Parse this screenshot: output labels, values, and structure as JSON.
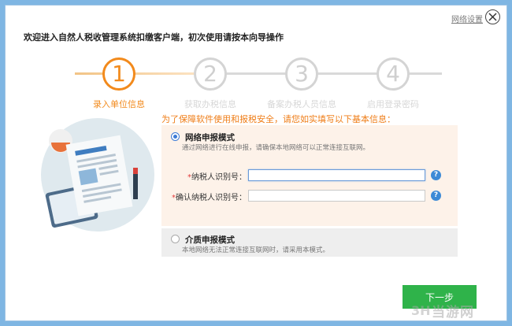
{
  "header": {
    "net_settings": "网络设置",
    "welcome": "欢迎进入自然人税收管理系统扣缴客户端，初次使用请按本向导操作"
  },
  "steps": [
    {
      "num": "1",
      "label": "录入单位信息"
    },
    {
      "num": "2",
      "label": "获取办税信息"
    },
    {
      "num": "3",
      "label": "备案办税人员信息"
    },
    {
      "num": "4",
      "label": "启用登录密码"
    }
  ],
  "form": {
    "hint": "为了保障软件使用和报税安全，请您如实填写以下基本信息：",
    "online": {
      "title": "网络申报模式",
      "desc": "通过网络进行在线申报，请确保本地网络可以正常连接互联网。",
      "selected": true
    },
    "taxpayer_id_label": "纳税人识别号：",
    "confirm_id_label": "确认纳税人识别号：",
    "required_mark": "*",
    "help_mark": "?",
    "media": {
      "title": "介质申报模式",
      "desc": "本地网络无法正常连接互联网时，请采用本模式。",
      "selected": false
    }
  },
  "footer": {
    "next_label": "下一步"
  },
  "watermark": {
    "text": "当游网"
  },
  "colors": {
    "accent": "#f28a1c",
    "primary_button": "#2fb34a",
    "info_blue": "#3d8ad6"
  }
}
